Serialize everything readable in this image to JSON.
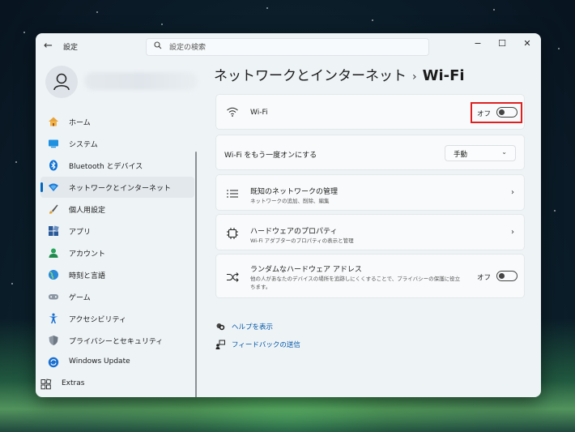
{
  "window": {
    "title": "設定",
    "search_placeholder": "設定の検索",
    "controls": {
      "minimize": "−",
      "maximize": "☐",
      "close": "✕"
    }
  },
  "sidebar": {
    "items": [
      {
        "label": "ホーム",
        "icon": "home-icon"
      },
      {
        "label": "システム",
        "icon": "system-icon"
      },
      {
        "label": "Bluetooth とデバイス",
        "icon": "bluetooth-icon"
      },
      {
        "label": "ネットワークとインターネット",
        "icon": "network-icon",
        "active": true
      },
      {
        "label": "個人用設定",
        "icon": "brush-icon"
      },
      {
        "label": "アプリ",
        "icon": "apps-icon"
      },
      {
        "label": "アカウント",
        "icon": "account-icon"
      },
      {
        "label": "時刻と言語",
        "icon": "globe-icon"
      },
      {
        "label": "ゲーム",
        "icon": "gamepad-icon"
      },
      {
        "label": "アクセシビリティ",
        "icon": "accessibility-icon"
      },
      {
        "label": "プライバシーとセキュリティ",
        "icon": "shield-icon"
      },
      {
        "label": "Windows Update",
        "icon": "update-icon"
      },
      {
        "label": "Extras",
        "icon": "extras-icon"
      }
    ]
  },
  "breadcrumb": {
    "parent": "ネットワークとインターネット",
    "separator": "›",
    "current": "Wi-Fi"
  },
  "cards": {
    "wifi": {
      "title": "Wi-Fi",
      "toggle_label": "オフ",
      "state": "off",
      "icon": "wifi-icon"
    },
    "auto_on": {
      "title": "Wi-Fi をもう一度オンにする",
      "dropdown_value": "手動"
    },
    "known_networks": {
      "title": "既知のネットワークの管理",
      "subtitle": "ネットワークの追加、削除、編集",
      "icon": "list-icon"
    },
    "hardware": {
      "title": "ハードウェアのプロパティ",
      "subtitle": "Wi-Fi アダプターのプロパティの表示と管理",
      "icon": "chip-icon"
    },
    "random_mac": {
      "title": "ランダムなハードウェア アドレス",
      "subtitle_line1": "他の人があなたのデバイスの場所を追跡しにくくすることで、プライバシーの保護に役立",
      "subtitle_line2": "ちます。",
      "toggle_label": "オフ",
      "state": "off",
      "icon": "shuffle-icon"
    }
  },
  "links": {
    "help": "ヘルプを表示",
    "feedback": "フィードバックの送信"
  },
  "colors": {
    "accent": "#0067c0",
    "highlight": "#e02020"
  }
}
